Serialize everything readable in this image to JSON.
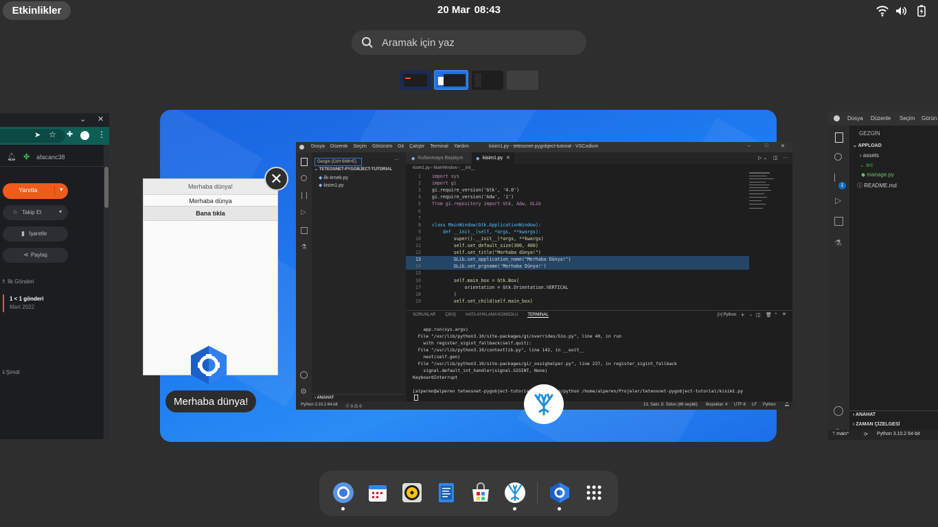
{
  "topbar": {
    "activities_label": "Etkinlikler",
    "date": "20 Mar",
    "time": "08:43",
    "icons": [
      "wifi-icon",
      "volume-icon",
      "battery-icon"
    ]
  },
  "search": {
    "placeholder": "Aramak için yaz"
  },
  "left_window": {
    "username": "afacanc38",
    "reply_button": "Yanıtla",
    "follow_button": "Takip Et",
    "mark_button": "İşaretle",
    "share_button": "Paylaş",
    "first_post": "İlk Gönderi",
    "post_title": "1 < 1 gönderi",
    "post_date": "Mart 2022",
    "now": "Şimdi"
  },
  "gtk_window": {
    "title": "Merhaba dünya!",
    "label": "Merhaba dünya",
    "button": "Bana tıkla",
    "caption": "Merhaba dünya!"
  },
  "vscode": {
    "menu": [
      "Dosya",
      "Düzenle",
      "Seçim",
      "Görünüm",
      "Git",
      "Çalıştır",
      "Terminal",
      "Yardım"
    ],
    "title": "kisim1.py - teteosnet-pygobject-tutorial - VSCodium",
    "explorer_input": "Gezgin (Ctrl+Shift+E)",
    "explorer_title": "TETEOSNET-PYGOBJECT-TUTORIAL",
    "files": [
      "ilk-örnek.py",
      "kisim1.py"
    ],
    "outline": "ANAHAT",
    "tabs": [
      "Kullanmaya Başlayın",
      "kisim1.py"
    ],
    "breadcrumb": [
      "kisim1.py",
      "MainWindow",
      "__init__"
    ],
    "code_lines": [
      {
        "n": "1",
        "t": "import sys"
      },
      {
        "n": "2",
        "t": "import gi"
      },
      {
        "n": "3",
        "t": "gi.require_version('Gtk', '4.0')"
      },
      {
        "n": "4",
        "t": "gi.require_version('Adw', '1')"
      },
      {
        "n": "5",
        "t": "from gi.repository import Gtk, Adw, GLib"
      },
      {
        "n": "6",
        "t": ""
      },
      {
        "n": "7",
        "t": ""
      },
      {
        "n": "8",
        "t": "class MainWindow(Gtk.ApplicationWindow):"
      },
      {
        "n": "9",
        "t": "    def __init__(self, *args, **kwargs):"
      },
      {
        "n": "10",
        "t": "        super().__init__(*args, **kwargs)"
      },
      {
        "n": "11",
        "t": "        self.set_default_size(300, 400)"
      },
      {
        "n": "12",
        "t": "        self.set_title(\"Merhaba dünya!\")"
      },
      {
        "n": "13",
        "t": "        GLib.set_application_name(\"Merhaba Dünya!\")"
      },
      {
        "n": "14",
        "t": "        GLib.set_prgname('Merhaba Dünya!')"
      },
      {
        "n": "15",
        "t": ""
      },
      {
        "n": "16",
        "t": "        self.main_box = Gtk.Box("
      },
      {
        "n": "17",
        "t": "            orientation = Gtk.Orientation.VERTICAL"
      },
      {
        "n": "18",
        "t": "        )"
      },
      {
        "n": "19",
        "t": "        self.set_child(self.main_box)"
      }
    ],
    "panel_tabs": [
      "SORUNLAR",
      "ÇIKIŞ",
      "HATA AYIKLAMA KONSOLU",
      "TERMİNAL"
    ],
    "terminal_kind": "Python",
    "terminal_lines": [
      "    app.run(sys.argv)",
      "  File \"/usr/lib/python3.10/site-packages/gi/overrides/Gio.py\", line 40, in run",
      "    with register_sigint_fallback(self.quit):",
      "  File \"/usr/lib/python3.10/contextlib.py\", line 142, in __exit__",
      "    next(self.gen)",
      "  File \"/usr/lib/python3.10/site-packages/gi/_ossighelper.py\", line 237, in register_sigint_fallback",
      "    signal.default_int_handler(signal.SIGINT, None)",
      "KeyboardInterrupt",
      "",
      "[alperen@alperen teteosnet-pygobject-tutorial]$ /usr/bin/python /home/alperen/Projeler/teteosnet-pygobject-tutorial/kisim1.py"
    ],
    "status_left": "Python 3.10.2 64-bit",
    "status_problems": "0 ⚠ 0",
    "status_right": [
      "13. Satır, 9. Sütun (86 seçildi)",
      "Boşluklar: 4",
      "UTF-8",
      "LF",
      "Python"
    ]
  },
  "right_window": {
    "menu": [
      "Dosya",
      "Düzenle",
      "Seçim",
      "Görün"
    ],
    "explorer_title": "GEZGİN",
    "project": "APPLOAD",
    "tree": [
      "assets",
      "src",
      "manage.py",
      "README.md"
    ],
    "outline": "ANAHAT",
    "timeline": "ZAMAN ÇİZELGESİ",
    "branch": "main*",
    "python": "Python 3.10.2 64-bit",
    "badge": "1"
  },
  "dock": {
    "apps": [
      "chromium-icon",
      "calendar-icon",
      "rhythmbox-icon",
      "text-editor-icon",
      "software-center-icon",
      "vscodium-icon",
      "pygobject-app-icon",
      "app-grid-icon"
    ]
  },
  "colors": {
    "accent_orange": "#f05a1a",
    "workspace_blue": "#1e7bf0",
    "dock_bg": "#3a3a3a"
  }
}
